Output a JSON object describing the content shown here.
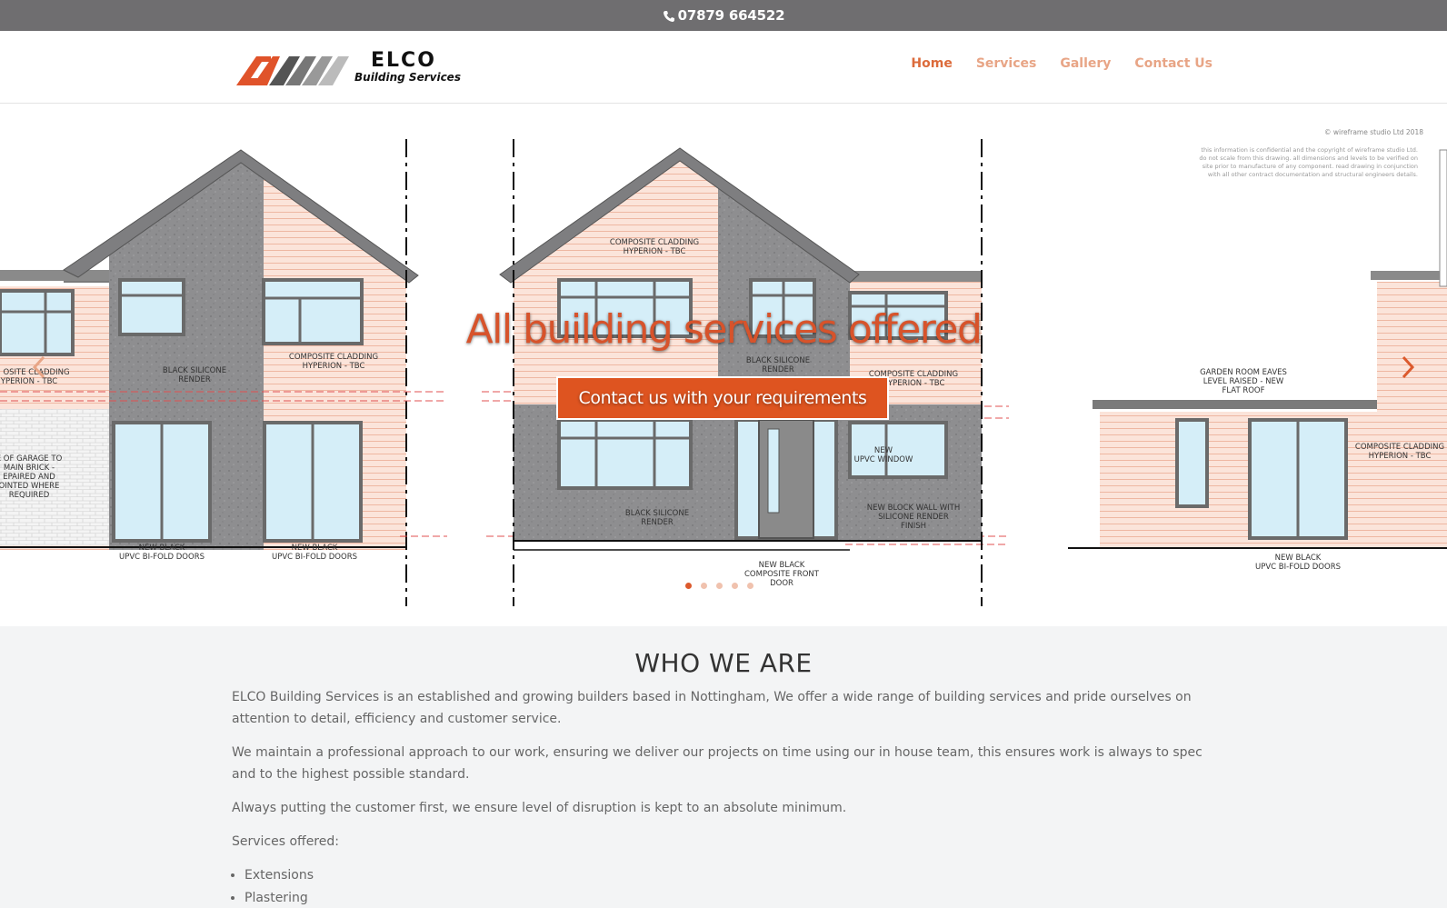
{
  "topbar": {
    "phone": "07879 664522",
    "icon": "phone-icon"
  },
  "header": {
    "logo": {
      "name": "ELCO",
      "subtitle": "Building Services"
    },
    "nav": [
      {
        "label": "Home",
        "active": true
      },
      {
        "label": "Services",
        "active": false
      },
      {
        "label": "Gallery",
        "active": false
      },
      {
        "label": "Contact Us",
        "active": false
      }
    ]
  },
  "hero": {
    "title": "All building services offered",
    "button_label": "Contact us with your requirements",
    "slide_count": 5,
    "active_slide": 1,
    "drawing": {
      "copyright": "© wireframe studio Ltd 2018",
      "notice": [
        "this information is confidential and the copyright of wireframe studio Ltd.",
        "do not scale from this drawing. all dimensions and levels to be verified on",
        "site prior to manufacture of any component. read drawing in conjunction",
        "with all other contract documentation and structural engineers details."
      ],
      "labels": {
        "left_cladding": [
          "OSITE CLADDING",
          "YPERION - TBC"
        ],
        "left_render": [
          "BLACK SILICONE",
          "RENDER"
        ],
        "left_composite": [
          "COMPOSITE CLADDING",
          "HYPERION - TBC"
        ],
        "garage_note": [
          "E OF GARAGE TO",
          "MAIN BRICK -",
          "EPAIRED AND",
          "OINTED WHERE",
          "REQUIRED"
        ],
        "left_doors_a": [
          "NEW BLACK",
          "UPVC BI-FOLD DOORS"
        ],
        "left_doors_b": [
          "NEW BLACK",
          "UPVC BI-FOLD DOORS"
        ],
        "mid_cladding": [
          "COMPOSITE CLADDING",
          "HYPERION - TBC"
        ],
        "mid_render_top": [
          "BLACK SILICONE",
          "RENDER"
        ],
        "mid_cladding_right": [
          "COMPOSITE CLADDING",
          "HYPERION - TBC"
        ],
        "mid_render_bottom": [
          "BLACK SILICONE",
          "RENDER"
        ],
        "mid_window": [
          "NEW",
          "UPVC WINDOW"
        ],
        "mid_block_wall": [
          "NEW BLOCK WALL WITH",
          "SILICONE RENDER",
          "FINISH"
        ],
        "mid_door": [
          "NEW BLACK",
          "COMPOSITE FRONT",
          "DOOR"
        ],
        "right_eaves": [
          "GARDEN ROOM EAVES",
          "LEVEL RAISED - NEW",
          "FLAT ROOF"
        ],
        "right_cladding": [
          "COMPOSITE CLADDING",
          "HYPERION - TBC"
        ],
        "right_doors": [
          "NEW BLACK",
          "UPVC BI-FOLD DOORS"
        ]
      }
    }
  },
  "about": {
    "heading": "WHO WE ARE",
    "paragraphs": [
      "ELCO Building Services is an established and growing builders based in Nottingham, We offer a wide range of building services and pride ourselves on attention to detail, efficiency and customer service.",
      "We maintain a professional approach to our work, ensuring we deliver our projects on time using our in house team, this ensures work is always to spec and to the highest possible standard.",
      "Always putting the customer first, we ensure level of disruption is kept to an absolute minimum.",
      "Services offered:"
    ],
    "services": [
      "Extensions",
      "Plastering"
    ]
  },
  "colors": {
    "accent": "#dc5a2d",
    "topbar": "#6f6e70",
    "nav_inactive": "#e8a586"
  }
}
